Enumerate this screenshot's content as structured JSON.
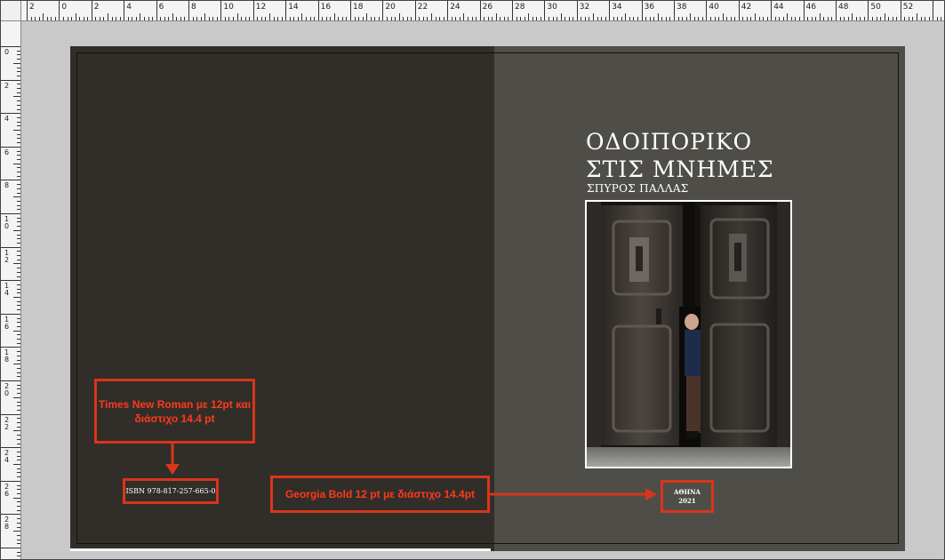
{
  "ruler": {
    "horizontal_labels": [
      "2",
      "0",
      "2",
      "4",
      "6",
      "8",
      "10",
      "12",
      "14",
      "16",
      "18",
      "20",
      "22",
      "24",
      "26",
      "28",
      "30",
      "32",
      "34",
      "36",
      "38",
      "40",
      "42",
      "44",
      "46",
      "48",
      "50",
      "52"
    ],
    "vertical_labels": [
      "0",
      "2",
      "4",
      "6",
      "8",
      "10",
      "12",
      "14",
      "16",
      "18",
      "20",
      "22",
      "24",
      "26",
      "28"
    ]
  },
  "cover": {
    "title_line1": "ΟΔΟΙΠΟΡΙΚΟ",
    "title_line2": "ΣΤΙΣ ΜΝΗΜΕΣ",
    "author": "ΣΠΥΡΟΣ ΠΑΛΛΑΣ",
    "place": "ΑΘΗΝΑ",
    "year": "2021",
    "isbn": "ISBN 978-817-257-665-0"
  },
  "annotations": {
    "font_note_1": "Times New Roman με 12pt και διάστιχο 14.4 pt",
    "font_note_2": "Georgia Bold 12 pt με διάστιχο 14.4pt"
  },
  "colors": {
    "left_page": "#312d29",
    "right_page": "#4f4d48",
    "annotation_red": "#d7361a"
  }
}
